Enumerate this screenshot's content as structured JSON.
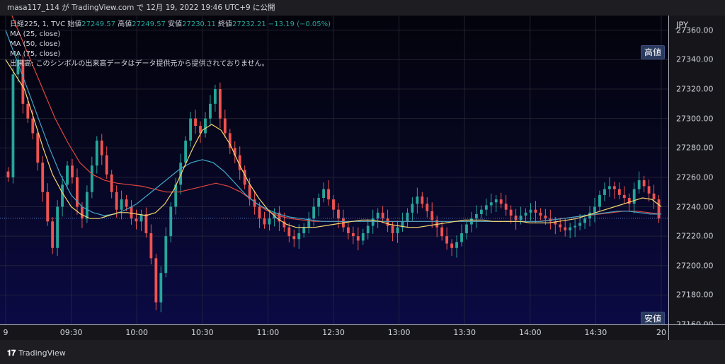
{
  "header": {
    "publish_line": "masa117_114 が TradingView.com で 12月 19, 2022 19:46 UTC+9 に公開"
  },
  "legend": {
    "symbol": "日経225, 1, TVC",
    "open_label": "始値",
    "open_value": "27249.57",
    "high_label": "高値",
    "high_value": "27249.57",
    "low_label": "安値",
    "low_value": "27230.11",
    "close_label": "終値",
    "close_value": "27232.21",
    "change": "−13.19 (−0.05%)",
    "ma1": "MA (25, close)",
    "ma2": "MA (50, close)",
    "ma3": "MA (75, close)",
    "volume_note": "出来高: このシンボルの出来高データはデータ提供元から提供されておりません。"
  },
  "badges": {
    "high": "高値",
    "low": "安値"
  },
  "footer": {
    "logo_mark": "𝟏𝟕",
    "logo_text": "TradingView"
  },
  "colors": {
    "up": "#26a69a",
    "down": "#ef5350",
    "ma25": "#f5d76e",
    "ma50": "#3fa7c7",
    "ma75": "#e0463f",
    "grid": "#2a2e39"
  },
  "chart_data": {
    "type": "candlestick",
    "currency": "JPY",
    "ylim": [
      27160,
      27370
    ],
    "y_ticks": [
      27160,
      27180,
      27200,
      27220,
      27240,
      27260,
      27280,
      27300,
      27320,
      27340,
      27360
    ],
    "y_tick_labels": [
      "27160.00",
      "27180.00",
      "27200.00",
      "27220.00",
      "27240.00",
      "27260.00",
      "27280.00",
      "27300.00",
      "27320.00",
      "27340.00",
      "27360.00"
    ],
    "x_tick_labels": [
      "9",
      "09:30",
      "10:00",
      "10:30",
      "11:00",
      "12:30",
      "13:00",
      "13:30",
      "14:00",
      "14:30",
      "20"
    ],
    "session_high": 27345,
    "session_low": 27163,
    "last_close": 27232.21,
    "close_series": [
      27260,
      27330,
      27340,
      27310,
      27300,
      27290,
      27270,
      27250,
      27230,
      27212,
      27240,
      27255,
      27268,
      27260,
      27240,
      27232,
      27250,
      27268,
      27285,
      27275,
      27262,
      27250,
      27238,
      27245,
      27240,
      27232,
      27230,
      27235,
      27222,
      27205,
      27175,
      27195,
      27220,
      27240,
      27255,
      27270,
      27285,
      27300,
      27295,
      27290,
      27300,
      27310,
      27320,
      27300,
      27290,
      27280,
      27275,
      27265,
      27255,
      27245,
      27240,
      27232,
      27228,
      27232,
      27236,
      27230,
      27226,
      27220,
      27218,
      27222,
      27226,
      27232,
      27240,
      27246,
      27252,
      27245,
      27238,
      27232,
      27226,
      27222,
      27220,
      27217,
      27222,
      27227,
      27232,
      27236,
      27232,
      27227,
      27222,
      27226,
      27230,
      27236,
      27242,
      27247,
      27242,
      27237,
      27231,
      27226,
      27220,
      27215,
      27212,
      27216,
      27222,
      27228,
      27232,
      27235,
      27238,
      27241,
      27243,
      27245,
      27242,
      27238,
      27234,
      27231,
      27234,
      27236,
      27238,
      27236,
      27234,
      27232,
      27230,
      27228,
      27226,
      27224,
      27226,
      27227,
      27229,
      27232,
      27236,
      27240,
      27248,
      27252,
      27254,
      27252,
      27248,
      27246,
      27242,
      27252,
      27258,
      27254,
      27249,
      27245,
      27232
    ],
    "ma25": [
      27340,
      27330,
      27320,
      27300,
      27280,
      27262,
      27250,
      27240,
      27235,
      27232,
      27232,
      27234,
      27236,
      27236,
      27235,
      27234,
      27236,
      27242,
      27252,
      27266,
      27280,
      27292,
      27296,
      27292,
      27282,
      27268,
      27256,
      27246,
      27238,
      27232,
      27228,
      27226,
      27226,
      27226,
      27227,
      27228,
      27229,
      27230,
      27231,
      27231,
      27230,
      27228,
      27227,
      27226,
      27226,
      27227,
      27228,
      27229,
      27230,
      27231,
      27231,
      27231,
      27230,
      27230,
      27230,
      27230,
      27229,
      27229,
      27229,
      27230,
      27231,
      27232,
      27234,
      27236,
      27238,
      27240,
      27242,
      27244,
      27246,
      27245,
      27240
    ],
    "ma50": [
      27360,
      27340,
      27320,
      27300,
      27280,
      27262,
      27248,
      27240,
      27236,
      27234,
      27235,
      27238,
      27242,
      27248,
      27254,
      27260,
      27266,
      27270,
      27272,
      27270,
      27264,
      27256,
      27248,
      27242,
      27238,
      27235,
      27233,
      27232,
      27231,
      27230,
      27230,
      27230,
      27230,
      27230,
      27230,
      27230,
      27230,
      27230,
      27230,
      27230,
      27230,
      27230,
      27230,
      27230,
      27230,
      27230,
      27230,
      27230,
      27230,
      27230,
      27231,
      27232,
      27233,
      27234,
      27235,
      27236,
      27237,
      27237,
      27236,
      27235,
      27235
    ],
    "ma75": [
      27380,
      27360,
      27340,
      27320,
      27300,
      27284,
      27270,
      27262,
      27258,
      27256,
      27255,
      27254,
      27252,
      27250,
      27250,
      27252,
      27254,
      27256,
      27254,
      27250,
      27244,
      27238,
      27234,
      27232,
      27231,
      27230,
      27230,
      27230,
      27230,
      27230,
      27230,
      27230,
      27230,
      27230,
      27230,
      27230,
      27230,
      27230,
      27230,
      27230,
      27230,
      27230,
      27230,
      27230,
      27231,
      27232,
      27233,
      27234,
      27235,
      27236,
      27237,
      27237,
      27236,
      27235
    ]
  }
}
